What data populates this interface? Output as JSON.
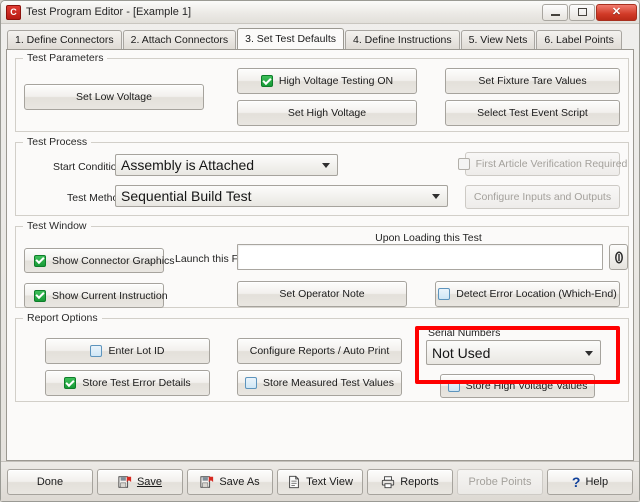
{
  "window": {
    "title": "Test Program Editor - [Example 1]",
    "app_icon": "app-c-icon",
    "controls": {
      "minimize": "minimize-icon",
      "maximize": "maximize-icon",
      "close": "✕"
    }
  },
  "tabs": [
    {
      "label": "1.  Define Connectors",
      "active": false
    },
    {
      "label": "2.  Attach Connectors",
      "active": false
    },
    {
      "label": "3.  Set Test Defaults",
      "active": true
    },
    {
      "label": "4.  Define Instructions",
      "active": false
    },
    {
      "label": "5.   View Nets",
      "active": false
    },
    {
      "label": "6.   Label Points",
      "active": false
    }
  ],
  "groups": {
    "test_parameters": {
      "legend": "Test Parameters",
      "buttons": [
        {
          "label": "Set Low Voltage",
          "checkbox": null,
          "disabled": false
        },
        {
          "label": "High Voltage Testing ON",
          "checkbox": "checked",
          "disabled": false
        },
        {
          "label": "Set High Voltage",
          "checkbox": null,
          "disabled": false
        },
        {
          "label": "Set Fixture Tare Values",
          "checkbox": null,
          "disabled": false
        },
        {
          "label": "Select Test Event Script",
          "checkbox": null,
          "disabled": false
        }
      ]
    },
    "test_process": {
      "legend": "Test Process",
      "start_condition": {
        "label": "Start Condition",
        "value": "Assembly is Attached"
      },
      "test_method": {
        "label": "Test Method",
        "value": "Sequential Build Test"
      },
      "buttons": [
        {
          "label": "First Article Verification Required",
          "checkbox": "unchecked-dim",
          "disabled": true
        },
        {
          "label": "Configure Inputs and Outputs",
          "checkbox": null,
          "disabled": true
        }
      ]
    },
    "test_window": {
      "legend": "Test Window",
      "upon_loading_label": "Upon Loading this Test",
      "launch_file_label": "Launch this File",
      "launch_file_value": "",
      "browse_icon": "attachment-icon",
      "buttons": [
        {
          "label": "Show Connector Graphics",
          "checkbox": "checked",
          "disabled": false
        },
        {
          "label": "Show Current Instruction",
          "checkbox": "checked",
          "disabled": false
        },
        {
          "label": "Set Operator Note",
          "checkbox": null,
          "disabled": false
        },
        {
          "label": "Detect Error Location (Which-End)",
          "checkbox": "unchecked",
          "disabled": false
        }
      ]
    },
    "report_options": {
      "legend": "Report Options",
      "buttons": [
        {
          "label": "Enter Lot ID",
          "checkbox": "unchecked",
          "disabled": false
        },
        {
          "label": "Configure Reports / Auto Print",
          "checkbox": null,
          "disabled": false
        },
        {
          "label": "Store Test Error Details",
          "checkbox": "checked",
          "disabled": false
        },
        {
          "label": "Store Measured Test Values",
          "checkbox": "unchecked",
          "disabled": false
        },
        {
          "label": "Store High Voltage Values",
          "checkbox": "unchecked",
          "disabled": false
        }
      ],
      "serial_numbers": {
        "label": "Serial Numbers",
        "value": "Not Used",
        "highlight_color": "#ff0000"
      }
    }
  },
  "bottom_bar": {
    "buttons": [
      {
        "label": "Done",
        "icon": null,
        "disabled": false
      },
      {
        "label": "Save",
        "icon": "save-icon",
        "disabled": false
      },
      {
        "label": "Save As",
        "icon": "save-as-icon",
        "disabled": false
      },
      {
        "label": "Text View",
        "icon": "document-icon",
        "disabled": false
      },
      {
        "label": "Reports",
        "icon": "printer-icon",
        "disabled": false
      },
      {
        "label": "Probe Points",
        "icon": null,
        "disabled": true
      },
      {
        "label": "Help",
        "icon": "question-icon",
        "disabled": false
      }
    ]
  }
}
